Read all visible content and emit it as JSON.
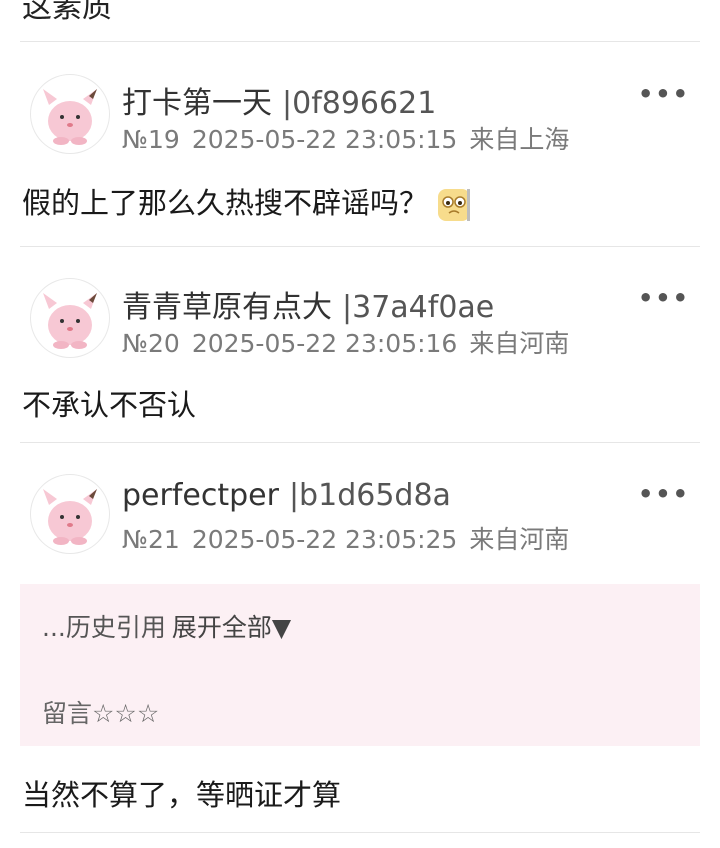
{
  "top_fragment": "这素质",
  "posts": [
    {
      "username": "打卡第一天",
      "uid": "|0f896621",
      "floor": "№19",
      "datetime": "2025-05-22 23:05:15",
      "location": "来自上海",
      "content": "假的上了那么久热搜不辟谣吗？",
      "more_icon": "•••"
    },
    {
      "username": "青青草原有点大",
      "uid": "|37a4f0ae",
      "floor": "№20",
      "datetime": "2025-05-22 23:05:16",
      "location": "来自河南",
      "content": "不承认不否认",
      "more_icon": "•••"
    },
    {
      "username": "perfectper",
      "uid": "|b1d65d8a",
      "floor": "№21",
      "datetime": "2025-05-22 23:05:25",
      "location": "来自河南",
      "quote_history": "...历史引用",
      "quote_expand": "展开全部▼",
      "quote_message": "留言☆☆☆",
      "content": "当然不算了，等晒证才算",
      "more_icon": "•••"
    }
  ]
}
